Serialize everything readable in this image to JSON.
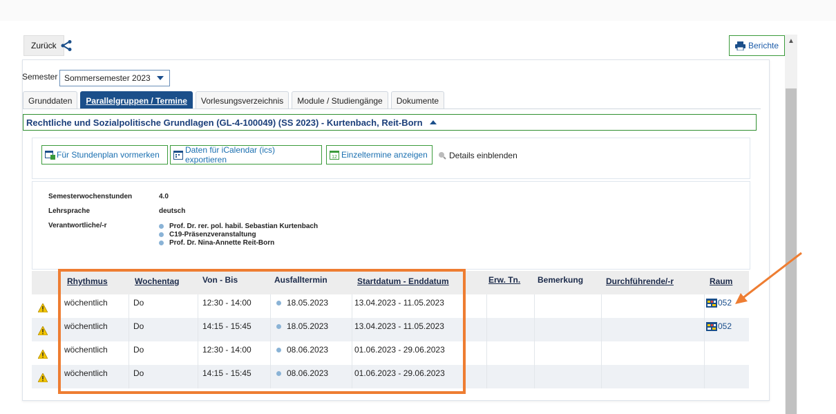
{
  "header": {
    "back_label": "Zurück",
    "share_icon": "share-icon",
    "reports_label": "Berichte"
  },
  "semester": {
    "label": "Semester",
    "selected": "Sommersemester 2023"
  },
  "tabs": [
    {
      "label": "Grunddaten"
    },
    {
      "label": "Parallelgruppen / Termine",
      "active": true
    },
    {
      "label": "Vorlesungsverzeichnis"
    },
    {
      "label": "Module / Studiengänge"
    },
    {
      "label": "Dokumente"
    }
  ],
  "course": {
    "title": "Rechtliche und Sozialpolitische Grundlagen (GL-4-100049) (SS 2023) - Kurtenbach, Reit-Born"
  },
  "actions": {
    "schedule": "Für Stundenplan vormerken",
    "ical": "Daten für iCalendar (ics) exportieren",
    "single": "Einzeltermine anzeigen",
    "details": "Details einblenden"
  },
  "info": {
    "sws_label": "Semesterwochenstunden",
    "sws_value": "4.0",
    "lang_label": "Lehrsprache",
    "lang_value": "deutsch",
    "resp_label": "Verantwortliche/-r",
    "responsible": [
      "Prof. Dr. rer. pol. habil. Sebastian Kurtenbach",
      "C19-Präsenzveranstaltung",
      "Prof. Dr. Nina-Annette Reit-Born"
    ]
  },
  "table": {
    "headers": {
      "rhythm": "Rhythmus",
      "weekday": "Wochentag",
      "time": "Von - Bis",
      "cancel": "Ausfalltermin",
      "dates": "Startdatum - Enddatum",
      "ext": "Erw. Tn.",
      "remark": "Bemerkung",
      "lecturer": "Durchführende/-r",
      "room": "Raum"
    },
    "rows": [
      {
        "rhythm": "wöchentlich",
        "weekday": "Do",
        "time": "12:30 - 14:00",
        "cancel": "18.05.2023",
        "dates": "13.04.2023 - 11.05.2023",
        "room": "052"
      },
      {
        "rhythm": "wöchentlich",
        "weekday": "Do",
        "time": "14:15 - 15:45",
        "cancel": "18.05.2023",
        "dates": "13.04.2023 - 11.05.2023",
        "room": "052"
      },
      {
        "rhythm": "wöchentlich",
        "weekday": "Do",
        "time": "12:30 - 14:00",
        "cancel": "08.06.2023",
        "dates": "01.06.2023 - 29.06.2023",
        "room": ""
      },
      {
        "rhythm": "wöchentlich",
        "weekday": "Do",
        "time": "14:15 - 15:45",
        "cancel": "08.06.2023",
        "dates": "01.06.2023 - 29.06.2023",
        "room": ""
      }
    ]
  },
  "colors": {
    "accent": "#1b4f8a",
    "highlight": "#ee7d32",
    "green": "#3a9a3a"
  }
}
